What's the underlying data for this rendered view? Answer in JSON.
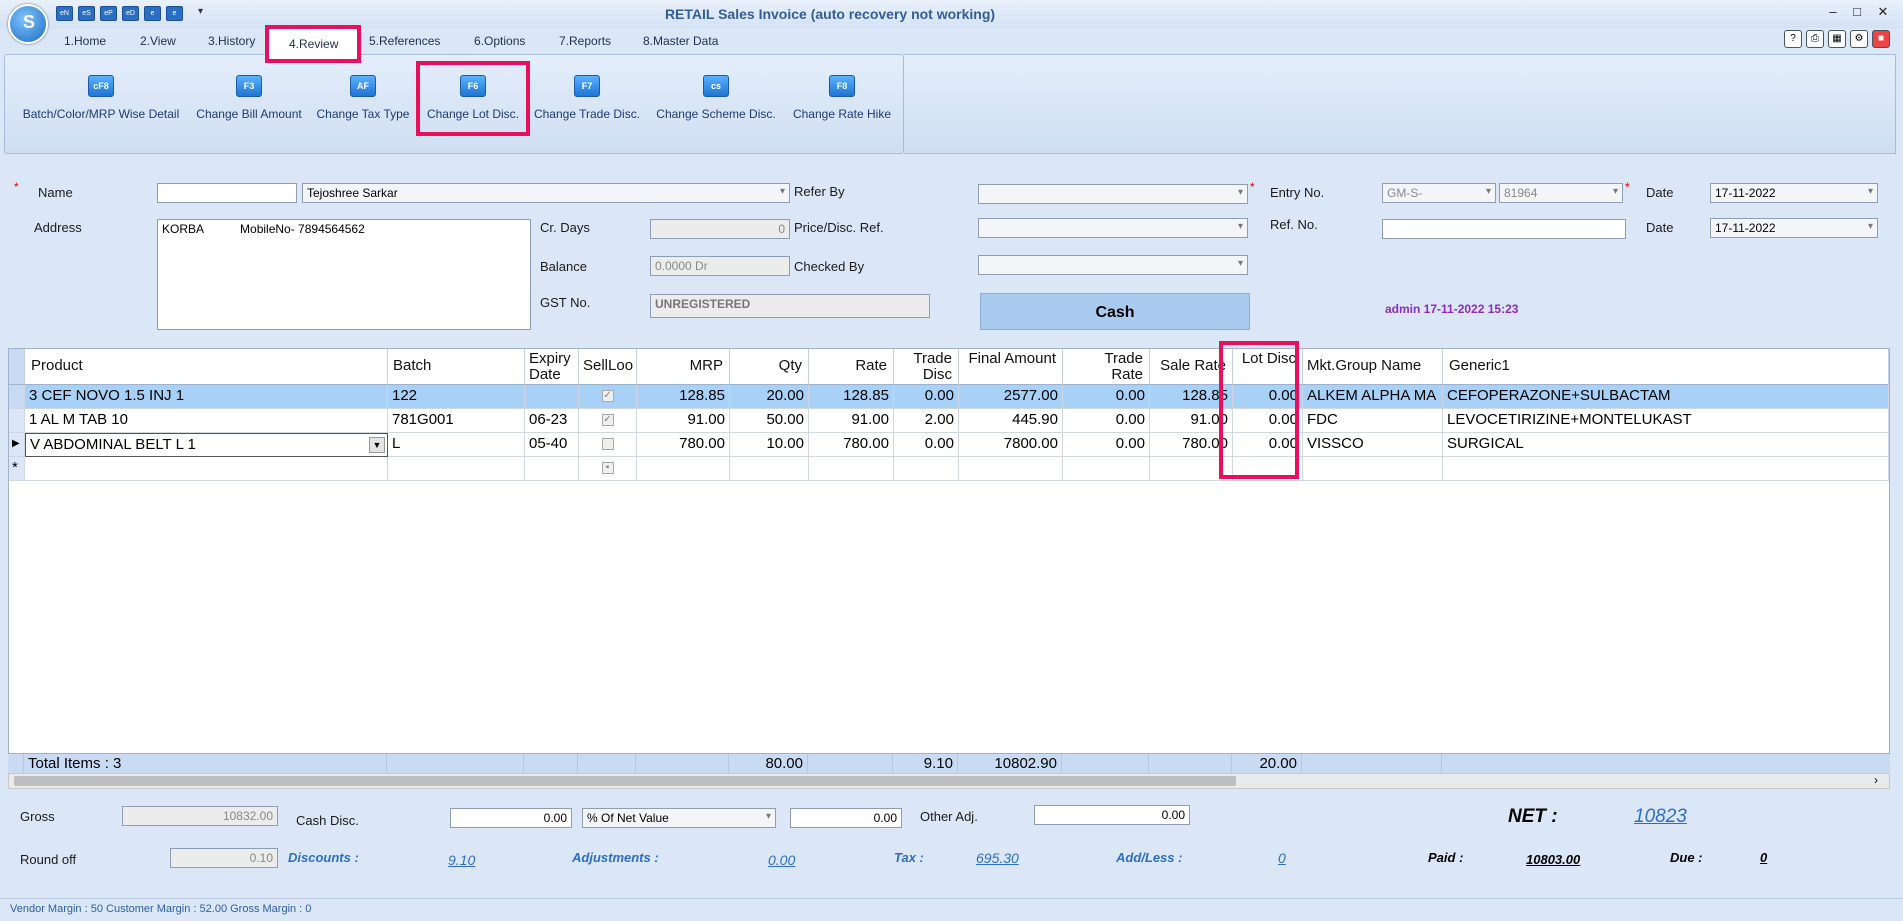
{
  "window": {
    "title": "RETAIL Sales Invoice (auto recovery not working)",
    "quick_access": [
      "eN",
      "eS",
      "eP",
      "eD",
      "e",
      "e"
    ],
    "minimize": "–",
    "maximize": "□",
    "close": "✕"
  },
  "tabs": [
    "1.Home",
    "2.View",
    "3.History",
    "4.Review",
    "5.References",
    "6.Options",
    "7.Reports",
    "8.Master Data"
  ],
  "ribbon": [
    {
      "label": "Batch/Color/MRP Wise Detail",
      "icon": "cF8"
    },
    {
      "label": "Change Bill Amount",
      "icon": "F3"
    },
    {
      "label": "Change Tax Type",
      "icon": "AF"
    },
    {
      "label": "Change Lot Disc.",
      "icon": "F6"
    },
    {
      "label": "Change Trade Disc.",
      "icon": "F7"
    },
    {
      "label": "Change Scheme Disc.",
      "icon": "cs"
    },
    {
      "label": "Change Rate Hike",
      "icon": "F8"
    }
  ],
  "form": {
    "name_label": "Name",
    "name_code": "",
    "name_value": "Tejoshree Sarkar",
    "address_label": "Address",
    "address_value": "KORBA           MobileNo- 7894564562",
    "cr_days_label": "Cr. Days",
    "cr_days_value": "0",
    "balance_label": "Balance",
    "balance_value": "0.0000 Dr",
    "gst_label": "GST No.",
    "gst_value": "UNREGISTERED",
    "refer_by_label": "Refer By",
    "price_disc_ref_label": "Price/Disc. Ref.",
    "checked_by_label": "Checked By",
    "payment_mode": "Cash",
    "entry_no_label": "Entry No.",
    "entry_prefix": "GM-S-",
    "entry_no": "81964",
    "ref_no_label": "Ref. No.",
    "date_label": "Date",
    "date_value": "17-11-2022",
    "ref_date_label": "Date",
    "ref_date_value": "17-11-2022",
    "admin_stamp": "admin 17-11-2022 15:23"
  },
  "grid": {
    "columns": [
      "Product",
      "Batch",
      "Expiry Date",
      "SellLoo",
      "MRP",
      "Qty",
      "Rate",
      "Trade Disc",
      "Final Amount",
      "Trade Rate",
      "Sale Rate",
      "Lot Disc",
      "Mkt.Group Name",
      "Generic1"
    ],
    "rows": [
      {
        "product": "3 CEF NOVO 1.5 INJ 1",
        "batch": "122",
        "expiry": "",
        "mrp": "128.85",
        "qty": "20.00",
        "rate": "128.85",
        "trade_disc": "0.00",
        "final_amount": "2577.00",
        "trade_rate": "0.00",
        "sale_rate": "128.85",
        "lot_disc": "0.00",
        "mkt_group": "ALKEM ALPHA MA",
        "generic": "CEFOPERAZONE+SULBACTAM"
      },
      {
        "product": "1 AL M TAB 10",
        "batch": "781G001",
        "expiry": "06-23",
        "mrp": "91.00",
        "qty": "50.00",
        "rate": "91.00",
        "trade_disc": "2.00",
        "final_amount": "445.90",
        "trade_rate": "0.00",
        "sale_rate": "91.00",
        "lot_disc": "0.00",
        "mkt_group": "FDC",
        "generic": "LEVOCETIRIZINE+MONTELUKAST"
      },
      {
        "product": "V ABDOMINAL BELT L 1",
        "batch": "L",
        "expiry": "05-40",
        "mrp": "780.00",
        "qty": "10.00",
        "rate": "780.00",
        "trade_disc": "0.00",
        "final_amount": "7800.00",
        "trade_rate": "0.00",
        "sale_rate": "780.00",
        "lot_disc": "0.00",
        "mkt_group": "VISSCO",
        "generic": "SURGICAL"
      }
    ],
    "totals": {
      "label": "Total Items : 3",
      "qty": "80.00",
      "trade_disc": "9.10",
      "final_amount": "10802.90",
      "lot_disc": "20.00"
    }
  },
  "footer": {
    "gross_label": "Gross",
    "gross_value": "10832.00",
    "round_off_label": "Round off",
    "round_off_value": "0.10",
    "cash_disc_label": "Cash Disc.",
    "cash_disc_value": "0.00",
    "cash_disc_mode": "% Of Net Value",
    "cash_disc_amount": "0.00",
    "other_adj_label": "Other Adj.",
    "other_adj_value": "0.00",
    "net_label": "NET :",
    "net_value": "10823",
    "discounts_label": "Discounts :",
    "discounts_value": "9.10",
    "adjustments_label": "Adjustments :",
    "adjustments_value": "0.00",
    "tax_label": "Tax :",
    "tax_value": "695.30",
    "add_less_label": "Add/Less :",
    "add_less_value": "0",
    "paid_label": "Paid :",
    "paid_value": "10803.00",
    "due_label": "Due :",
    "due_value": "0"
  },
  "status_bar": "Vendor Margin : 50 Customer Margin : 52.00 Gross Margin : 0",
  "colors": {
    "highlight": "#e8105a",
    "selected_row": "#a8d1f7",
    "accent": "#2d6fc4"
  }
}
